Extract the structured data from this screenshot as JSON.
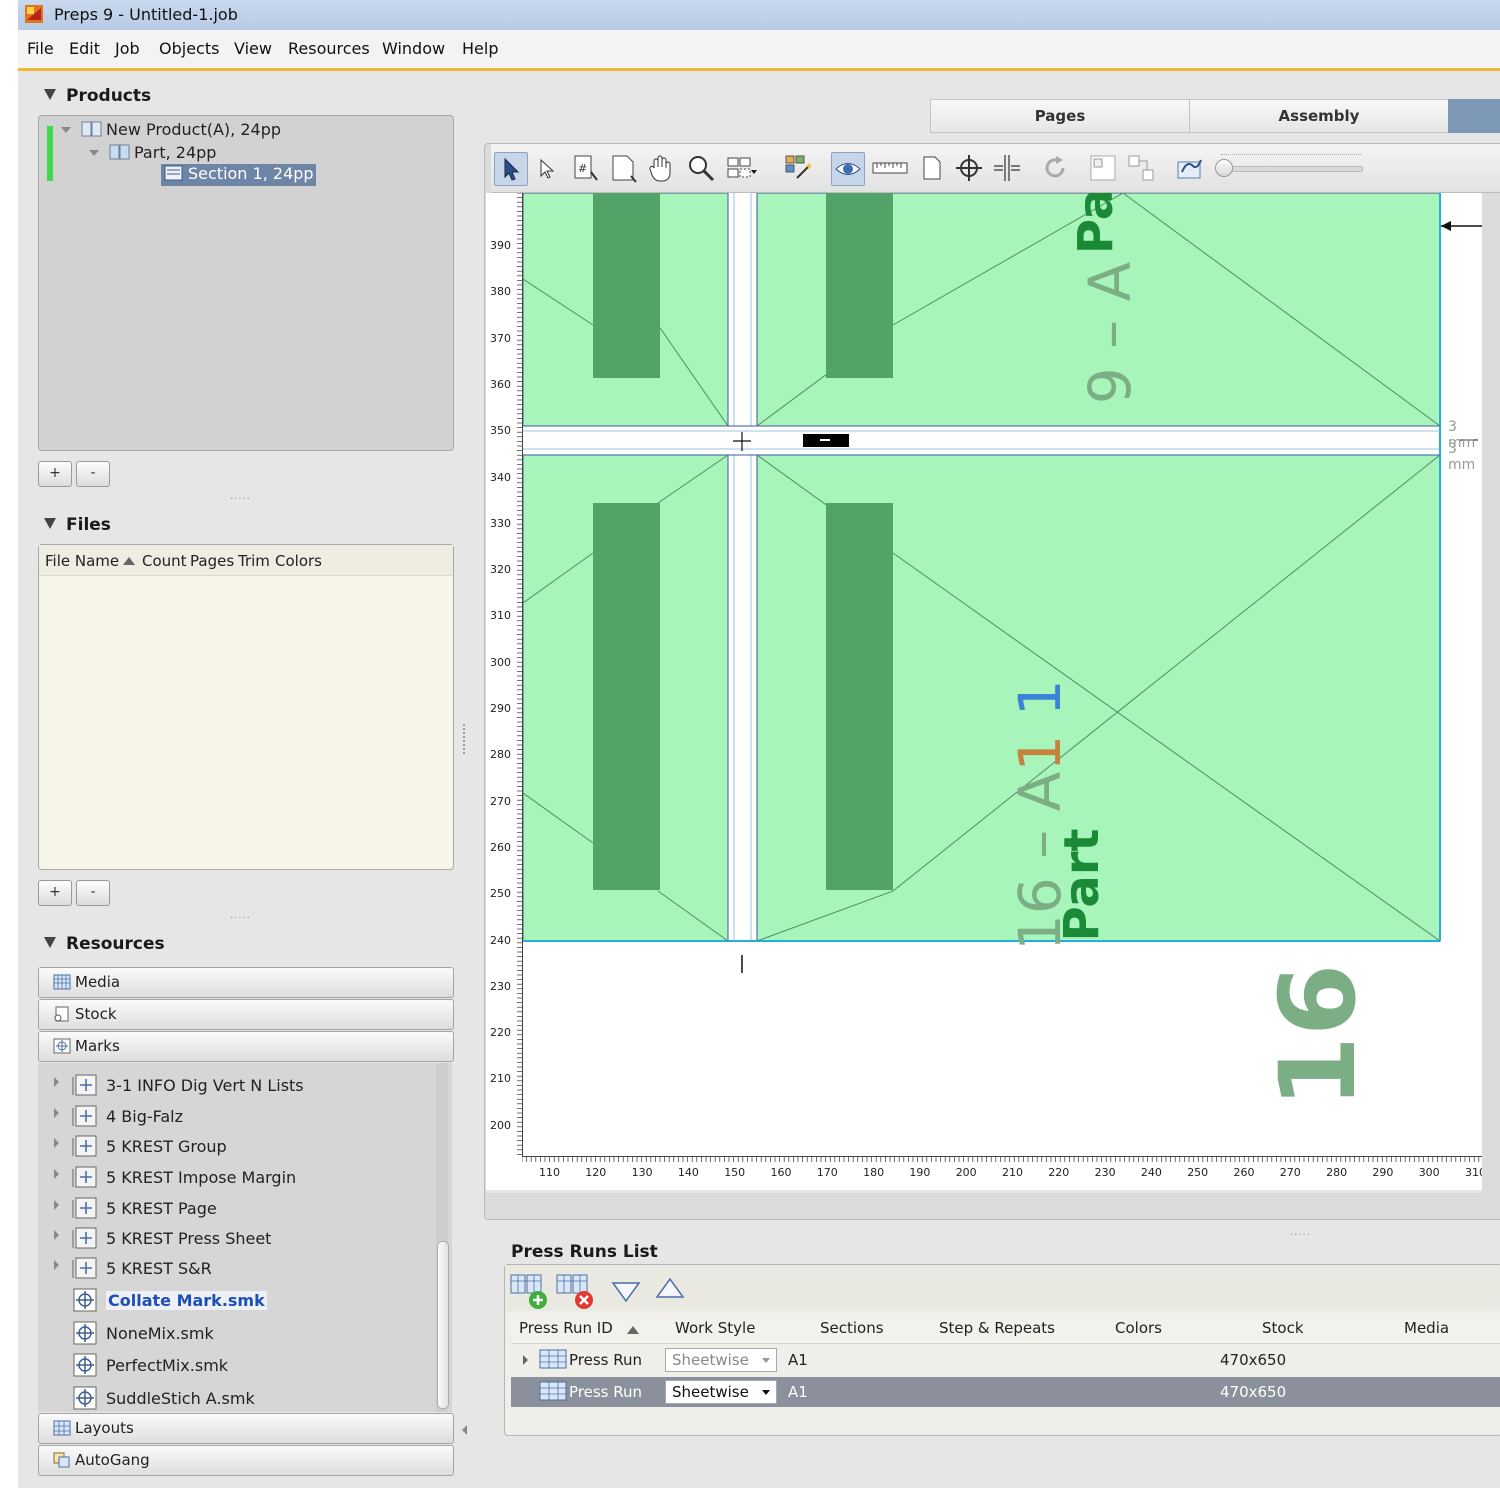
{
  "window": {
    "title": "Preps 9 - Untitled-1.job"
  },
  "menu": [
    "File",
    "Edit",
    "Job",
    "Objects",
    "View",
    "Resources",
    "Window",
    "Help"
  ],
  "products": {
    "heading": "Products",
    "tree": [
      "New Product(A), 24pp",
      "Part, 24pp",
      "Section 1, 24pp"
    ],
    "add_label": "+",
    "remove_label": "-"
  },
  "files": {
    "heading": "Files",
    "columns": [
      "File Name",
      "Count",
      "Pages",
      "Trim",
      "Colors"
    ],
    "add_label": "+",
    "remove_label": "-"
  },
  "resources": {
    "heading": "Resources",
    "groups": [
      "Media",
      "Stock",
      "Marks",
      "Layouts",
      "AutoGang"
    ],
    "marks": [
      "3-1 INFO Dig Vert N Lists",
      "4 Big-Falz",
      "5 KREST Group",
      "5 KREST Impose Margin",
      "5 KREST Page",
      "5 KREST Press Sheet",
      "5 KREST S&R",
      "Collate Mark.smk",
      "NoneMix.smk",
      "PerfectMix.smk",
      "SuddleStich A.smk"
    ]
  },
  "tabs": [
    "Pages",
    "Assembly"
  ],
  "canvas": {
    "y_ticks": [
      "390",
      "380",
      "370",
      "360",
      "350",
      "340",
      "330",
      "320",
      "310",
      "300",
      "290",
      "280",
      "270",
      "260",
      "250",
      "240",
      "230",
      "220",
      "210",
      "200"
    ],
    "x_ticks": [
      "110",
      "120",
      "130",
      "140",
      "150",
      "160",
      "170",
      "180",
      "190",
      "200",
      "210",
      "220",
      "230",
      "240",
      "250",
      "260",
      "270",
      "280",
      "290",
      "300",
      "310"
    ],
    "gap_labels": [
      "3 mm",
      "3 mm"
    ],
    "page_texts": {
      "top_number": "9 – A",
      "top_part": "Pa",
      "bottom_part": "Part",
      "bottom_code_prefix": "16 – A",
      "bottom_code_mid": "1",
      "bottom_code_end": "1",
      "big_number": "16"
    },
    "colors": {
      "page_fill": "#a8f5bb",
      "margin_block": "#52a367",
      "page_text": "#7cae86",
      "accent_blue": "#3a84d8",
      "accent_orange": "#c7823e"
    }
  },
  "press_runs": {
    "title": "Press Runs List",
    "columns": [
      "Press Run ID",
      "Work Style",
      "Sections",
      "Step & Repeats",
      "Colors",
      "Stock",
      "Media"
    ],
    "rows": [
      {
        "id": "Press Run",
        "work_style": "Sheetwise",
        "sections": "A1",
        "stock": "470x650"
      },
      {
        "id": "Press Run",
        "work_style": "Sheetwise",
        "sections": "A1",
        "stock": "470x650"
      }
    ]
  }
}
